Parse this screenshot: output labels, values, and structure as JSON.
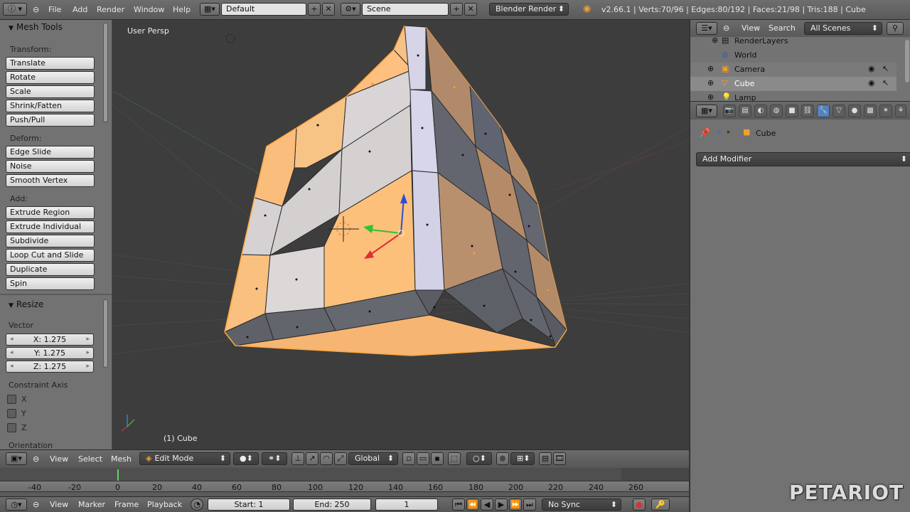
{
  "topbar": {
    "menus": [
      "File",
      "Add",
      "Render",
      "Window",
      "Help"
    ],
    "screen_layout": "Default",
    "scene": "Scene",
    "engine": "Blender Render",
    "stats": "v2.66.1 | Verts:70/96 | Edges:80/192 | Faces:21/98 | Tris:188 | Cube"
  },
  "toolshelf": {
    "title": "Mesh Tools",
    "transform_label": "Transform:",
    "transform_buttons": [
      "Translate",
      "Rotate",
      "Scale",
      "Shrink/Fatten",
      "Push/Pull"
    ],
    "deform_label": "Deform:",
    "deform_buttons": [
      "Edge Slide",
      "Noise",
      "Smooth Vertex"
    ],
    "add_label": "Add:",
    "add_buttons": [
      "Extrude Region",
      "Extrude Individual",
      "Subdivide",
      "Loop Cut and Slide",
      "Duplicate",
      "Spin"
    ],
    "operator_title": "Resize",
    "vector_label": "Vector",
    "vector": [
      "X: 1.275",
      "Y: 1.275",
      "Z: 1.275"
    ],
    "constraint_label": "Constraint Axis",
    "constraint_axes": [
      "X",
      "Y",
      "Z"
    ],
    "orientation_label": "Orientation"
  },
  "viewport": {
    "view_label": "User Persp",
    "object_label": "(1) Cube"
  },
  "header3d": {
    "menus": [
      "View",
      "Select",
      "Mesh"
    ],
    "mode": "Edit Mode",
    "orientation": "Global"
  },
  "timeline": {
    "ticks": [
      "-40",
      "-20",
      "0",
      "20",
      "40",
      "60",
      "80",
      "100",
      "120",
      "140",
      "160",
      "180",
      "200",
      "220",
      "240",
      "260"
    ],
    "menus": [
      "View",
      "Marker",
      "Frame",
      "Playback"
    ],
    "start": "Start: 1",
    "end": "End: 250",
    "current": "1",
    "sync": "No Sync"
  },
  "outliner": {
    "view_label": "View",
    "search_label": "Search",
    "filter": "All Scenes",
    "items": [
      "RenderLayers",
      "World",
      "Camera",
      "Cube",
      "Lamp"
    ]
  },
  "properties": {
    "context_object": "Cube",
    "add_modifier": "Add Modifier"
  },
  "watermark": "PETARIOT"
}
